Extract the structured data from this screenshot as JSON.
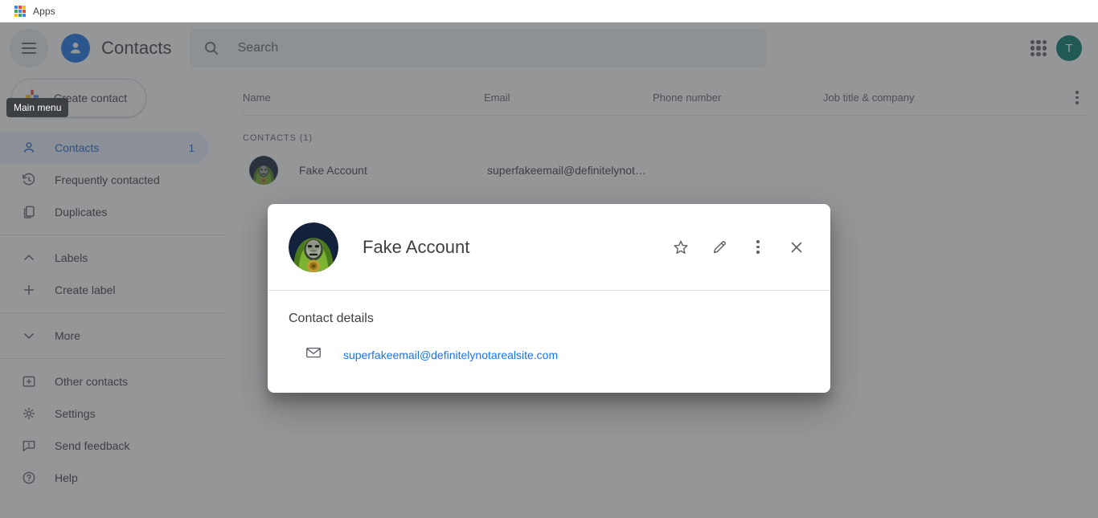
{
  "browser": {
    "bookmark_label": "Apps",
    "bookmark_icon": "google-apps-grid-icon"
  },
  "header": {
    "menu_icon": "hamburger-menu-icon",
    "menu_tooltip": "Main menu",
    "brand_icon": "contacts-person-logo",
    "brand_name": "Contacts",
    "search": {
      "icon": "search-icon",
      "placeholder": "Search",
      "value": ""
    },
    "apps_icon": "app-grid-icon",
    "avatar_initial": "T",
    "avatar_color": "#00796b"
  },
  "sidebar": {
    "create_button": {
      "label": "Create contact",
      "icon": "google-plus-icon"
    },
    "items": [
      {
        "label": "Contacts",
        "icon": "person-icon",
        "count": "1",
        "active": true
      },
      {
        "label": "Frequently contacted",
        "icon": "history-clock-icon",
        "count": "",
        "active": false
      },
      {
        "label": "Duplicates",
        "icon": "duplicate-pages-icon",
        "count": "",
        "active": false
      }
    ],
    "labels_section": [
      {
        "label": "Labels",
        "icon": "chevron-up-icon"
      },
      {
        "label": "Create label",
        "icon": "plus-icon"
      }
    ],
    "more_section": [
      {
        "label": "More",
        "icon": "chevron-down-icon"
      }
    ],
    "footer_items": [
      {
        "label": "Other contacts",
        "icon": "other-contacts-icon"
      },
      {
        "label": "Settings",
        "icon": "gear-icon"
      },
      {
        "label": "Send feedback",
        "icon": "feedback-icon"
      },
      {
        "label": "Help",
        "icon": "help-circle-icon"
      }
    ]
  },
  "main": {
    "columns": {
      "name": "Name",
      "email": "Email",
      "phone": "Phone number",
      "job": "Job title & company"
    },
    "more_icon": "vertical-dots-icon",
    "group_title": "CONTACTS (1)",
    "rows": [
      {
        "name": "Fake Account",
        "email": "superfakeemail@definitelynot…",
        "phone": "",
        "job": "",
        "avatar": "doom-portrait-avatar"
      }
    ]
  },
  "modal": {
    "avatar": "doom-portrait-avatar",
    "title": "Fake Account",
    "actions": [
      {
        "name": "favorite",
        "icon": "star-outline-icon"
      },
      {
        "name": "edit",
        "icon": "pencil-icon"
      },
      {
        "name": "more",
        "icon": "vertical-dots-icon"
      },
      {
        "name": "close",
        "icon": "close-x-icon"
      }
    ],
    "section_title": "Contact details",
    "details": [
      {
        "icon": "envelope-icon",
        "value": "superfakeemail@definitelynotarealsite.com",
        "link_color": "#1a73e8"
      }
    ]
  }
}
